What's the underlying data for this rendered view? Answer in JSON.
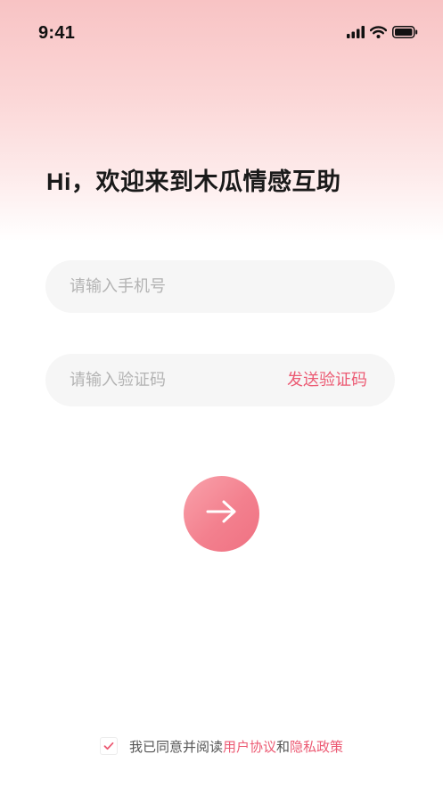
{
  "status_bar": {
    "time": "9:41",
    "icons": [
      "cellular-signal-icon",
      "wifi-icon",
      "battery-icon"
    ]
  },
  "welcome": {
    "title": "Hi，欢迎来到木瓜情感互助"
  },
  "form": {
    "phone_placeholder": "请输入手机号",
    "code_placeholder": "请输入验证码",
    "send_code_label": "发送验证码",
    "submit_icon": "arrow-right-icon"
  },
  "agreement": {
    "checked": true,
    "prefix": "我已同意并阅读",
    "user_agreement": "用户协议",
    "conjunction": "和",
    "privacy_policy": "隐私政策"
  },
  "colors": {
    "accent": "#ec5a73",
    "button_gradient_start": "#f9a2ab",
    "button_gradient_end": "#ef7182",
    "header_gradient": "#f8c3c4",
    "input_background": "#f6f6f6"
  }
}
